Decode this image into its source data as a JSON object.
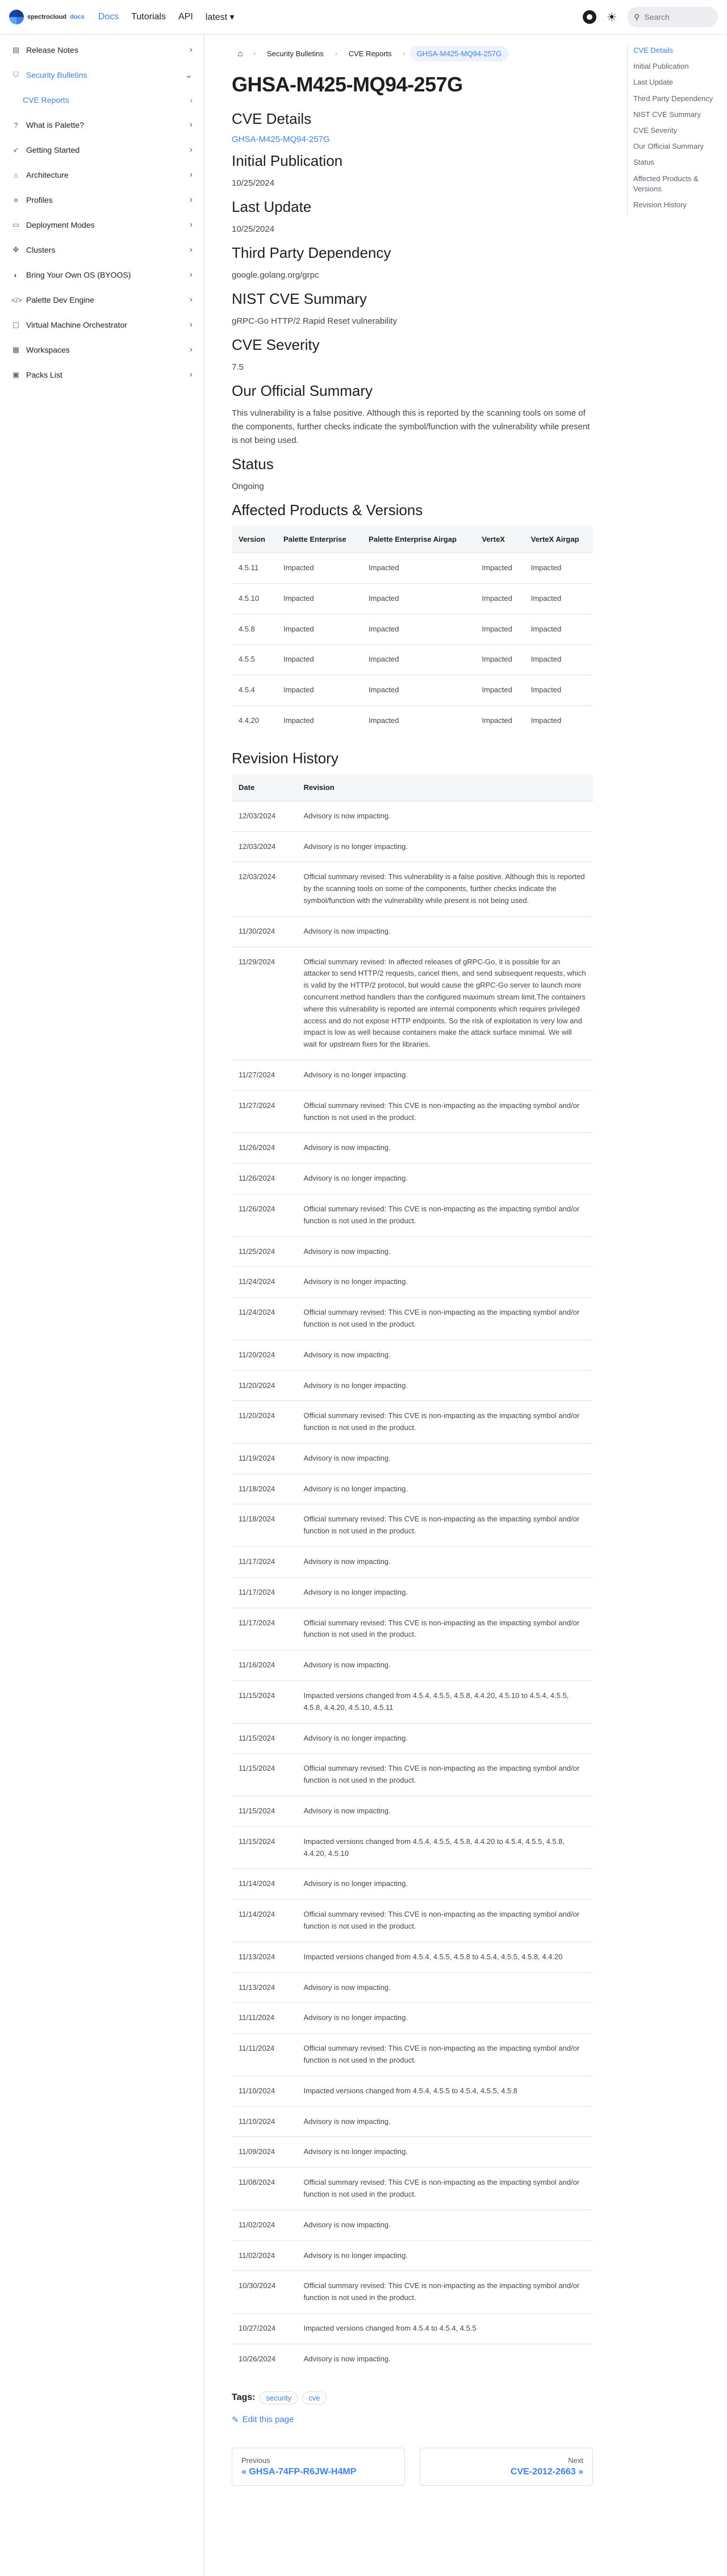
{
  "navbar": {
    "logo_text": "spectrocloud",
    "logo_badge": "docs",
    "links": [
      "Docs",
      "Tutorials",
      "API"
    ],
    "version": "latest ▾",
    "search_placeholder": "Search"
  },
  "sidebar": {
    "items": [
      {
        "label": "Release Notes"
      },
      {
        "label": "Security Bulletins"
      },
      {
        "label": "What is Palette?"
      },
      {
        "label": "Getting Started"
      },
      {
        "label": "Architecture"
      },
      {
        "label": "Profiles"
      },
      {
        "label": "Deployment Modes"
      },
      {
        "label": "Clusters"
      },
      {
        "label": "Bring Your Own OS (BYOOS)"
      },
      {
        "label": "Palette Dev Engine"
      },
      {
        "label": "Virtual Machine Orchestrator"
      },
      {
        "label": "Workspaces"
      },
      {
        "label": "Packs List"
      }
    ],
    "sub_item": "CVE Reports"
  },
  "breadcrumb": [
    "Security Bulletins",
    "CVE Reports",
    "GHSA-M425-MQ94-257G"
  ],
  "title": "GHSA-M425-MQ94-257G",
  "sections": {
    "cve_details": {
      "heading": "CVE Details",
      "value": "GHSA-M425-MQ94-257G"
    },
    "initial_pub": {
      "heading": "Initial Publication",
      "value": "10/25/2024"
    },
    "last_update": {
      "heading": "Last Update",
      "value": "10/25/2024"
    },
    "third_party": {
      "heading": "Third Party Dependency",
      "value": "google.golang.org/grpc"
    },
    "nist": {
      "heading": "NIST CVE Summary",
      "value": "gRPC-Go HTTP/2 Rapid Reset vulnerability"
    },
    "severity": {
      "heading": "CVE Severity",
      "value": "7.5"
    },
    "summary": {
      "heading": "Our Official Summary",
      "value": "This vulnerability is a false positive. Although this is reported by the scanning tools on some of the components, further checks indicate the symbol/function with the vulnerability while present is not being used."
    },
    "status": {
      "heading": "Status",
      "value": "Ongoing"
    },
    "affected": {
      "heading": "Affected Products & Versions"
    },
    "revision": {
      "heading": "Revision History"
    }
  },
  "affected_table": {
    "headers": [
      "Version",
      "Palette Enterprise",
      "Palette Enterprise Airgap",
      "VerteX",
      "VerteX Airgap"
    ],
    "rows": [
      [
        "4.5.11",
        "Impacted",
        "Impacted",
        "Impacted",
        "Impacted"
      ],
      [
        "4.5.10",
        "Impacted",
        "Impacted",
        "Impacted",
        "Impacted"
      ],
      [
        "4.5.8",
        "Impacted",
        "Impacted",
        "Impacted",
        "Impacted"
      ],
      [
        "4.5.5",
        "Impacted",
        "Impacted",
        "Impacted",
        "Impacted"
      ],
      [
        "4.5.4",
        "Impacted",
        "Impacted",
        "Impacted",
        "Impacted"
      ],
      [
        "4.4.20",
        "Impacted",
        "Impacted",
        "Impacted",
        "Impacted"
      ]
    ]
  },
  "revision_table": {
    "headers": [
      "Date",
      "Revision"
    ],
    "rows": [
      [
        "12/03/2024",
        "Advisory is now impacting."
      ],
      [
        "12/03/2024",
        "Advisory is no longer impacting."
      ],
      [
        "12/03/2024",
        "Official summary revised: This vulnerability is a false positive. Although this is reported by the scanning tools on some of the components, further checks indicate the symbol/function with the vulnerability while present is not being used."
      ],
      [
        "11/30/2024",
        "Advisory is now impacting."
      ],
      [
        "11/29/2024",
        "Official summary revised: In affected releases of gRPC-Go, it is possible for an attacker to send HTTP/2 requests, cancel them, and send subsequent requests, which is valid by the HTTP/2 protocol, but would cause the gRPC-Go server to launch more concurrent method handlers than the configured maximum stream limit.The containers where this vulnerability is reported are internal components which requires privileged access and do not expose HTTP endpoints. So the risk of exploitation is very low and impact is low as well because containers make the attack surface minimal. We will wait for upstream fixes for the libraries."
      ],
      [
        "11/27/2024",
        "Advisory is no longer impacting."
      ],
      [
        "11/27/2024",
        "Official summary revised: This CVE is non-impacting as the impacting symbol and/or function is not used in the product."
      ],
      [
        "11/26/2024",
        "Advisory is now impacting."
      ],
      [
        "11/26/2024",
        "Advisory is no longer impacting."
      ],
      [
        "11/26/2024",
        "Official summary revised: This CVE is non-impacting as the impacting symbol and/or function is not used in the product."
      ],
      [
        "11/25/2024",
        "Advisory is now impacting."
      ],
      [
        "11/24/2024",
        "Advisory is no longer impacting."
      ],
      [
        "11/24/2024",
        "Official summary revised: This CVE is non-impacting as the impacting symbol and/or function is not used in the product."
      ],
      [
        "11/20/2024",
        "Advisory is now impacting."
      ],
      [
        "11/20/2024",
        "Advisory is no longer impacting."
      ],
      [
        "11/20/2024",
        "Official summary revised: This CVE is non-impacting as the impacting symbol and/or function is not used in the product."
      ],
      [
        "11/19/2024",
        "Advisory is now impacting."
      ],
      [
        "11/18/2024",
        "Advisory is no longer impacting."
      ],
      [
        "11/18/2024",
        "Official summary revised: This CVE is non-impacting as the impacting symbol and/or function is not used in the product."
      ],
      [
        "11/17/2024",
        "Advisory is now impacting."
      ],
      [
        "11/17/2024",
        "Advisory is no longer impacting."
      ],
      [
        "11/17/2024",
        "Official summary revised: This CVE is non-impacting as the impacting symbol and/or function is not used in the product."
      ],
      [
        "11/16/2024",
        "Advisory is now impacting."
      ],
      [
        "11/15/2024",
        "Impacted versions changed from 4.5.4, 4.5.5, 4.5.8, 4.4.20, 4.5.10 to 4.5.4, 4.5.5, 4.5.8, 4.4.20, 4.5.10, 4.5.11"
      ],
      [
        "11/15/2024",
        "Advisory is no longer impacting."
      ],
      [
        "11/15/2024",
        "Official summary revised: This CVE is non-impacting as the impacting symbol and/or function is not used in the product."
      ],
      [
        "11/15/2024",
        "Advisory is now impacting."
      ],
      [
        "11/15/2024",
        "Impacted versions changed from 4.5.4, 4.5.5, 4.5.8, 4.4.20 to 4.5.4, 4.5.5, 4.5.8, 4.4.20, 4.5.10"
      ],
      [
        "11/14/2024",
        "Advisory is no longer impacting."
      ],
      [
        "11/14/2024",
        "Official summary revised: This CVE is non-impacting as the impacting symbol and/or function is not used in the product."
      ],
      [
        "11/13/2024",
        "Impacted versions changed from 4.5.4, 4.5.5, 4.5.8 to 4.5.4, 4.5.5, 4.5.8, 4.4.20"
      ],
      [
        "11/13/2024",
        "Advisory is now impacting."
      ],
      [
        "11/11/2024",
        "Advisory is no longer impacting."
      ],
      [
        "11/11/2024",
        "Official summary revised: This CVE is non-impacting as the impacting symbol and/or function is not used in the product."
      ],
      [
        "11/10/2024",
        "Impacted versions changed from 4.5.4, 4.5.5 to 4.5.4, 4.5.5, 4.5.8"
      ],
      [
        "11/10/2024",
        "Advisory is now impacting."
      ],
      [
        "11/09/2024",
        "Advisory is no longer impacting."
      ],
      [
        "11/08/2024",
        "Official summary revised: This CVE is non-impacting as the impacting symbol and/or function is not used in the product."
      ],
      [
        "11/02/2024",
        "Advisory is now impacting."
      ],
      [
        "11/02/2024",
        "Advisory is no longer impacting."
      ],
      [
        "10/30/2024",
        "Official summary revised: This CVE is non-impacting as the impacting symbol and/or function is not used in the product."
      ],
      [
        "10/27/2024",
        "Impacted versions changed from 4.5.4 to 4.5.4, 4.5.5"
      ],
      [
        "10/26/2024",
        "Advisory is now impacting."
      ]
    ]
  },
  "tags": {
    "label": "Tags:",
    "items": [
      "security",
      "cve"
    ]
  },
  "edit_label": "Edit this page",
  "pager": {
    "prev_sub": "Previous",
    "prev_label": "« GHSA-74FP-R6JW-H4MP",
    "next_sub": "Next",
    "next_label": "CVE-2012-2663 »"
  },
  "toc": [
    "CVE Details",
    "Initial Publication",
    "Last Update",
    "Third Party Dependency",
    "NIST CVE Summary",
    "CVE Severity",
    "Our Official Summary",
    "Status",
    "Affected Products & Versions",
    "Revision History"
  ]
}
